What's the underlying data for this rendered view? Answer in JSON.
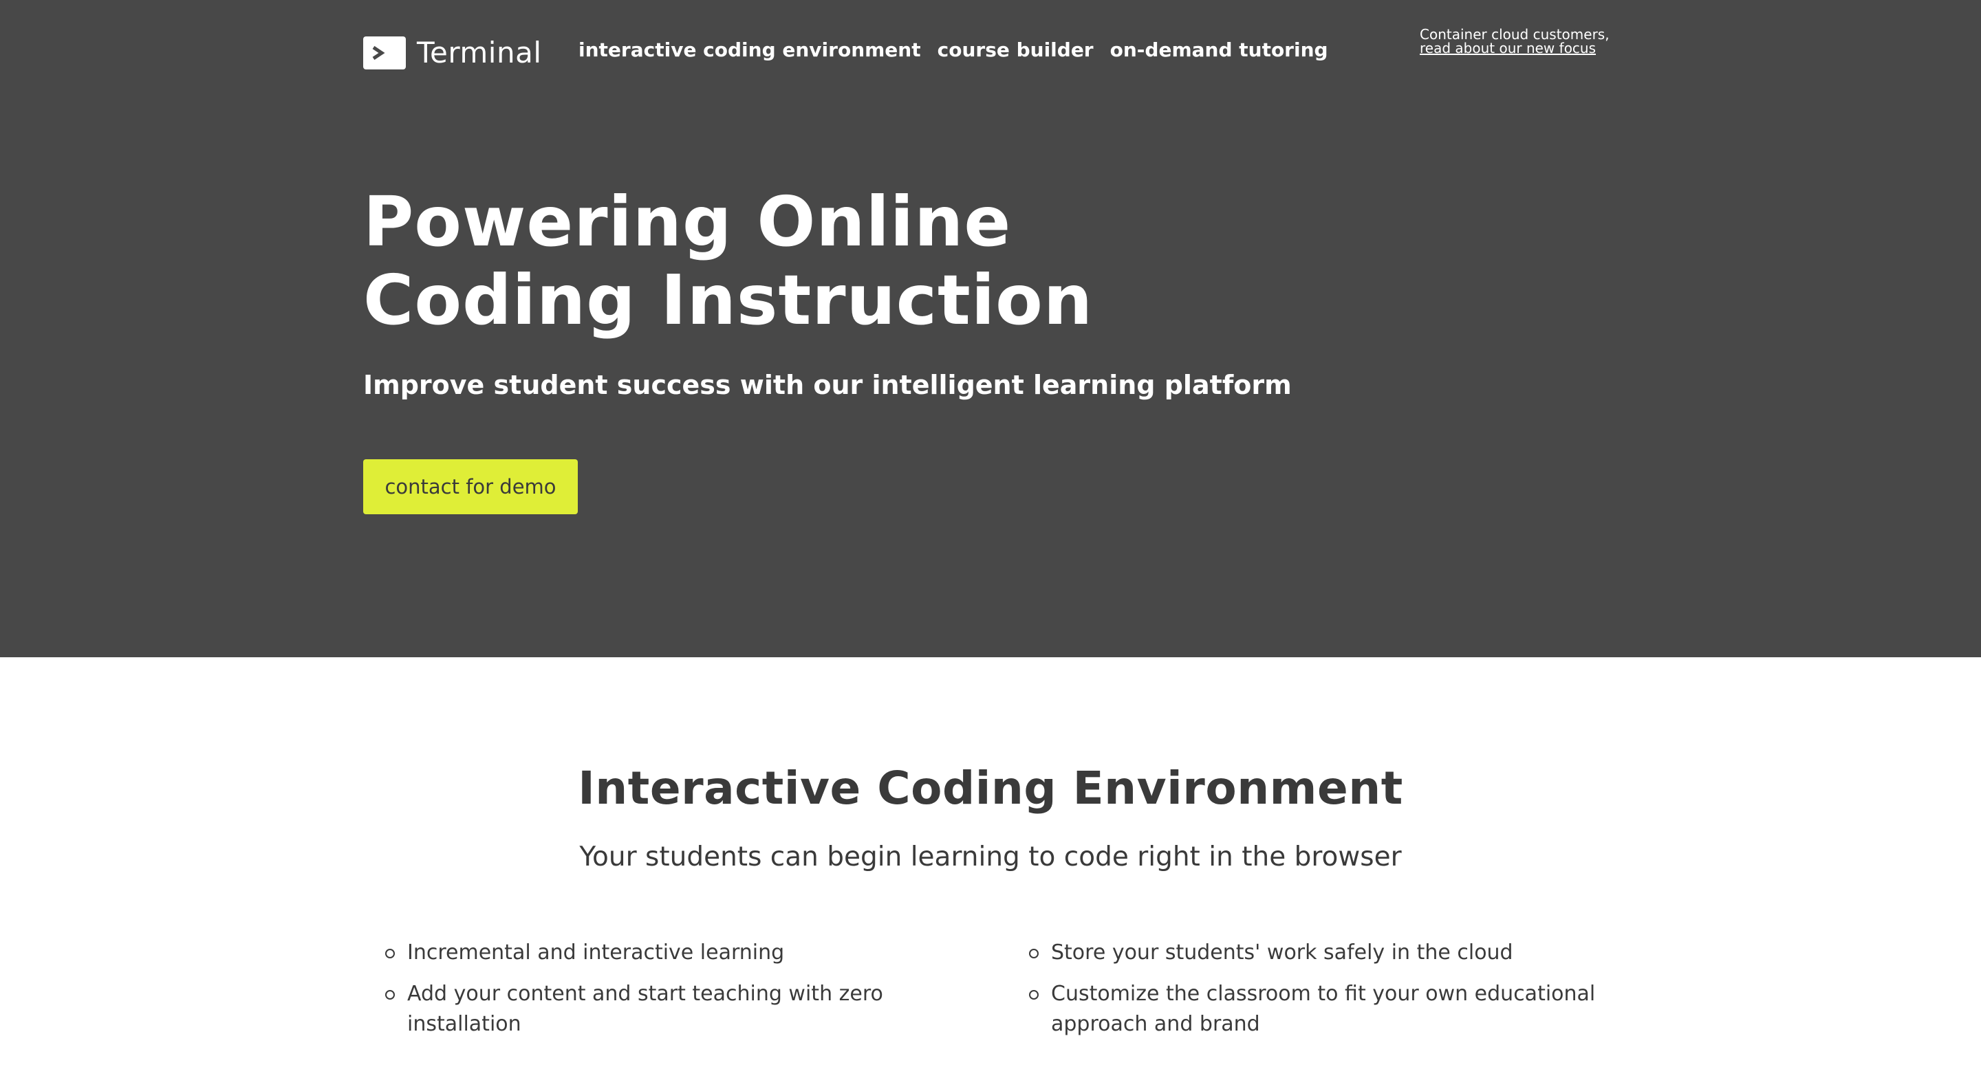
{
  "brand": {
    "name": "Terminal",
    "logo_icon": "terminal-prompt-icon"
  },
  "nav": {
    "items": [
      {
        "label": "interactive coding environment"
      },
      {
        "label": "course builder"
      },
      {
        "label": "on-demand tutoring"
      }
    ]
  },
  "notice": {
    "line": "Container cloud customers,",
    "link": "read about our new focus"
  },
  "hero": {
    "title_line1": "Powering Online",
    "title_line2": "Coding Instruction",
    "subtitle": "Improve student success with our intelligent learning platform",
    "cta_label": "contact for demo"
  },
  "section": {
    "title": "Interactive Coding Environment",
    "subtitle": "Your students can begin learning to code right in the browser",
    "features_left": [
      "Incremental and interactive learning",
      "Add your content and start teaching with zero installation"
    ],
    "features_right": [
      "Store your students' work safely in the cloud",
      "Customize the classroom to fit your own educational approach and brand"
    ]
  },
  "colors": {
    "hero_bg": "#484848",
    "accent": "#dfee37",
    "text_dark": "#3a3a3a"
  }
}
